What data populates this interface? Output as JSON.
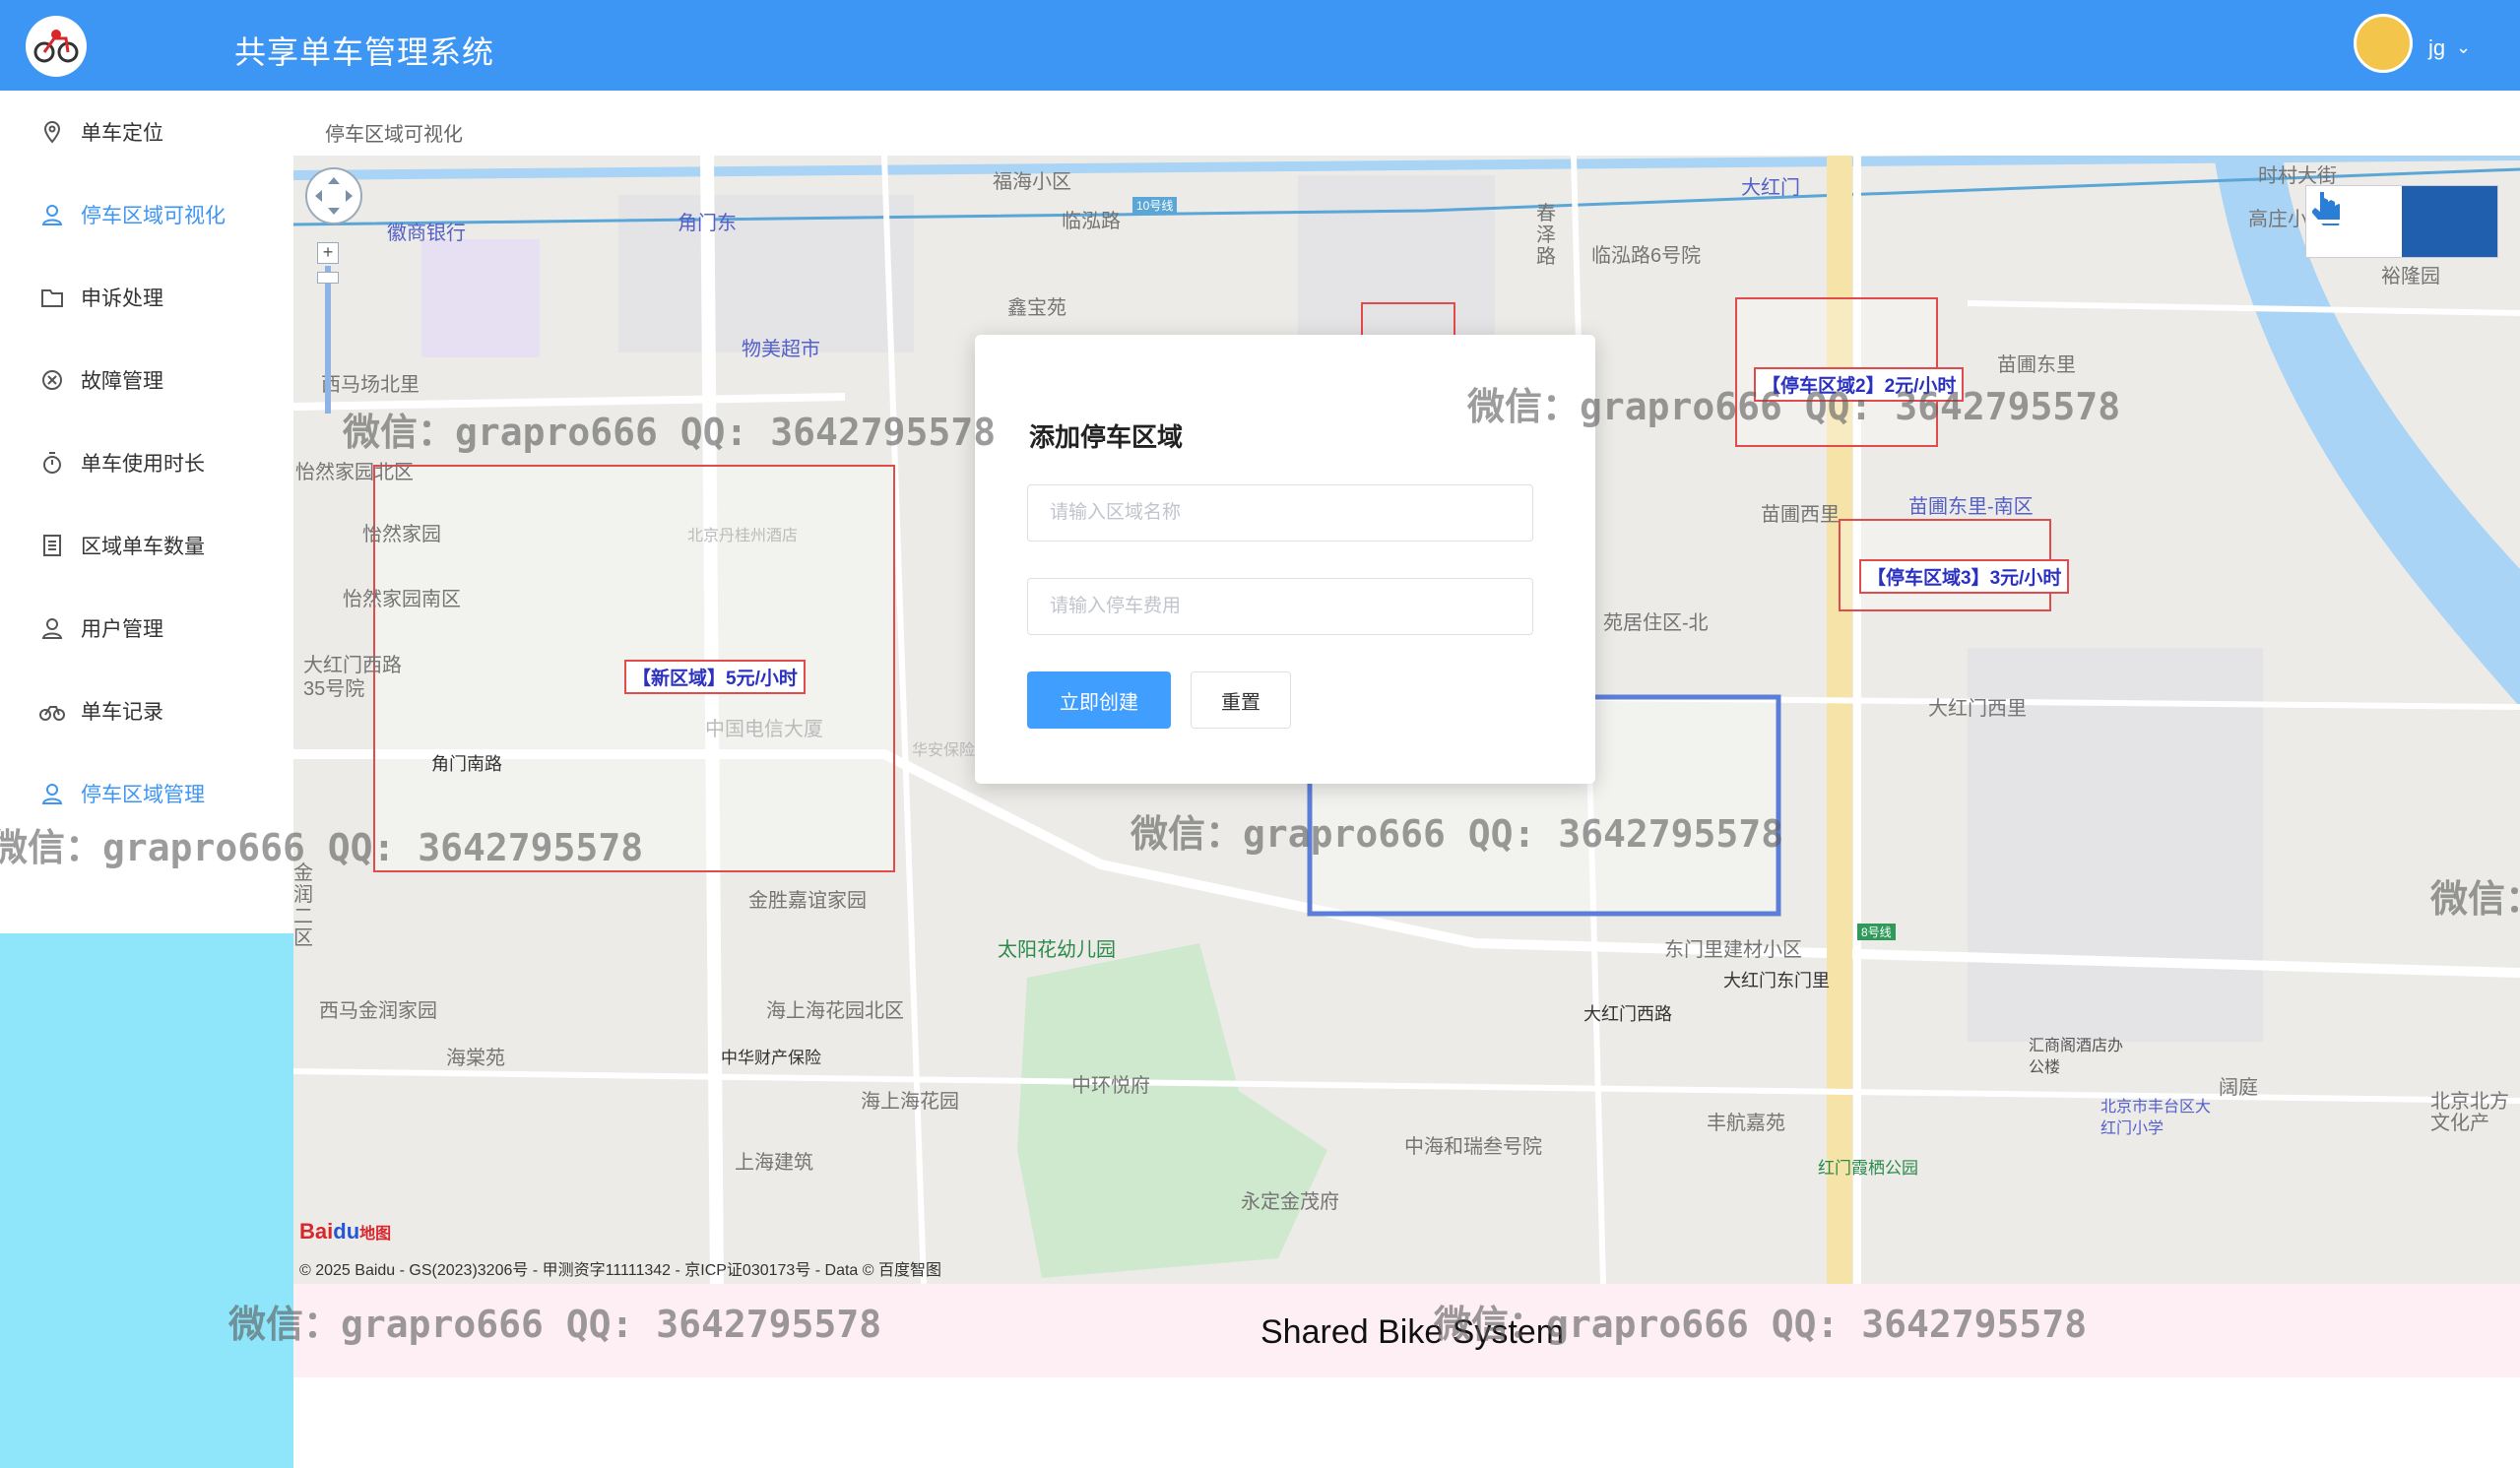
{
  "header": {
    "app_title": "共享单车管理系统",
    "user_name": "jg"
  },
  "sidebar": {
    "items": [
      {
        "label": "单车定位",
        "icon": "location-pin-icon",
        "active": false
      },
      {
        "label": "停车区域可视化",
        "icon": "user-icon",
        "active": true
      },
      {
        "label": "申诉处理",
        "icon": "folder-icon",
        "active": false
      },
      {
        "label": "故障管理",
        "icon": "close-circle-icon",
        "active": false
      },
      {
        "label": "单车使用时长",
        "icon": "timer-icon",
        "active": false
      },
      {
        "label": "区域单车数量",
        "icon": "document-icon",
        "active": false
      },
      {
        "label": "用户管理",
        "icon": "user-icon",
        "active": false
      },
      {
        "label": "单车记录",
        "icon": "bicycle-icon",
        "active": false
      },
      {
        "label": "停车区域管理",
        "icon": "user-icon",
        "active": true
      }
    ]
  },
  "breadcrumb": "停车区域可视化",
  "map": {
    "zones": [
      {
        "label": "【新区域】5元/小时"
      },
      {
        "label": "【停车区域2】2元/小时"
      },
      {
        "label": "【停车区域3】3元/小时"
      }
    ],
    "places": [
      "福海小区",
      "临泓路",
      "角门东",
      "徽商银行",
      "物美超市",
      "鑫宝苑",
      "春泽路",
      "临泓路6号院",
      "大红门",
      "时村大街",
      "高庄小区",
      "裕隆园",
      "苗圃东里",
      "苗圃西里",
      "苗圃东里-南区",
      "苑居住区-北",
      "大红门西里",
      "西马场北里",
      "怡然家园北区",
      "怡然家园",
      "怡然家园南区",
      "大红门西路35号院",
      "角门南路",
      "金胜嘉谊家园",
      "太阳花幼儿园",
      "西马金润家园",
      "海棠苑",
      "海上海花园北区",
      "中华财产保险",
      "海上海花园",
      "中环悦府",
      "上海建筑",
      "中海和瑞叁号院",
      "永定金茂府",
      "丰航嘉苑",
      "东门里建材小区",
      "大红门东门里",
      "大红门西路",
      "汇商阁酒店办公楼",
      "北京市丰台区大红门小学",
      "红门霞栖公园",
      "阔庭",
      "北京北方文化产",
      "金润二区",
      "北京丹桂州酒店",
      "中国电信大厦",
      "华安保险",
      "10号线",
      "8号线"
    ],
    "copyright": "© 2025 Baidu - GS(2023)3206号 - 甲测资字11111342 - 京ICP证030173号 - Data © 百度智图",
    "baidu_logo": {
      "a": "Bai",
      "b": "du",
      "c": "地图"
    }
  },
  "modal": {
    "title": "添加停车区域",
    "name_placeholder": "请输入区域名称",
    "fee_placeholder": "请输入停车费用",
    "create_label": "立即创建",
    "reset_label": "重置"
  },
  "footer": {
    "text": "Shared Bike System"
  },
  "watermark": {
    "text": "微信：grapro666 QQ: 3642795578",
    "short": "微信："
  },
  "colors": {
    "header": "#3d95f4",
    "primary": "#409eff",
    "active": "#3d95f4",
    "zone_red": "#e14b4b",
    "zone_blue": "#5b7fd8"
  }
}
